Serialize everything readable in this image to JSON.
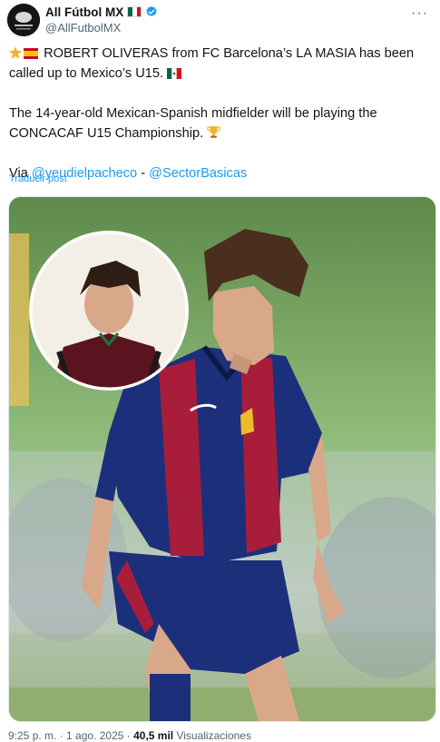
{
  "author": {
    "display_name": "All Fútbol MX",
    "handle": "@AllFutbolMX",
    "flag_colors": [
      "#006847",
      "#ffffff",
      "#ce1126"
    ],
    "verified_color": "#1d9bf0"
  },
  "more_icon": "more-horizontal-icon",
  "tweet": {
    "line1": "ROBERT OLIVERAS from FC Barcelona’s LA MASIA has been called up to Mexico’s U15.",
    "line2": "The 14-year-old Mexican-Spanish midfielder will be playing the CONCACAF U15 Championship.",
    "via_label": "Via",
    "mention1": "@yeudielpacheco",
    "separator": "-",
    "mention2": "@SectorBasicas"
  },
  "translate_label": "Traducir post",
  "media": {
    "type": "photo",
    "colors": {
      "barca_blue": "#1c2f7a",
      "barca_red": "#a81e3a",
      "background_green": "#7aa86a"
    }
  },
  "footer": {
    "time_text": "9:25 p. m. · 1 ago. 2025 ·",
    "views_count": "40,5 mil",
    "views_label": "Visualizaciones"
  }
}
